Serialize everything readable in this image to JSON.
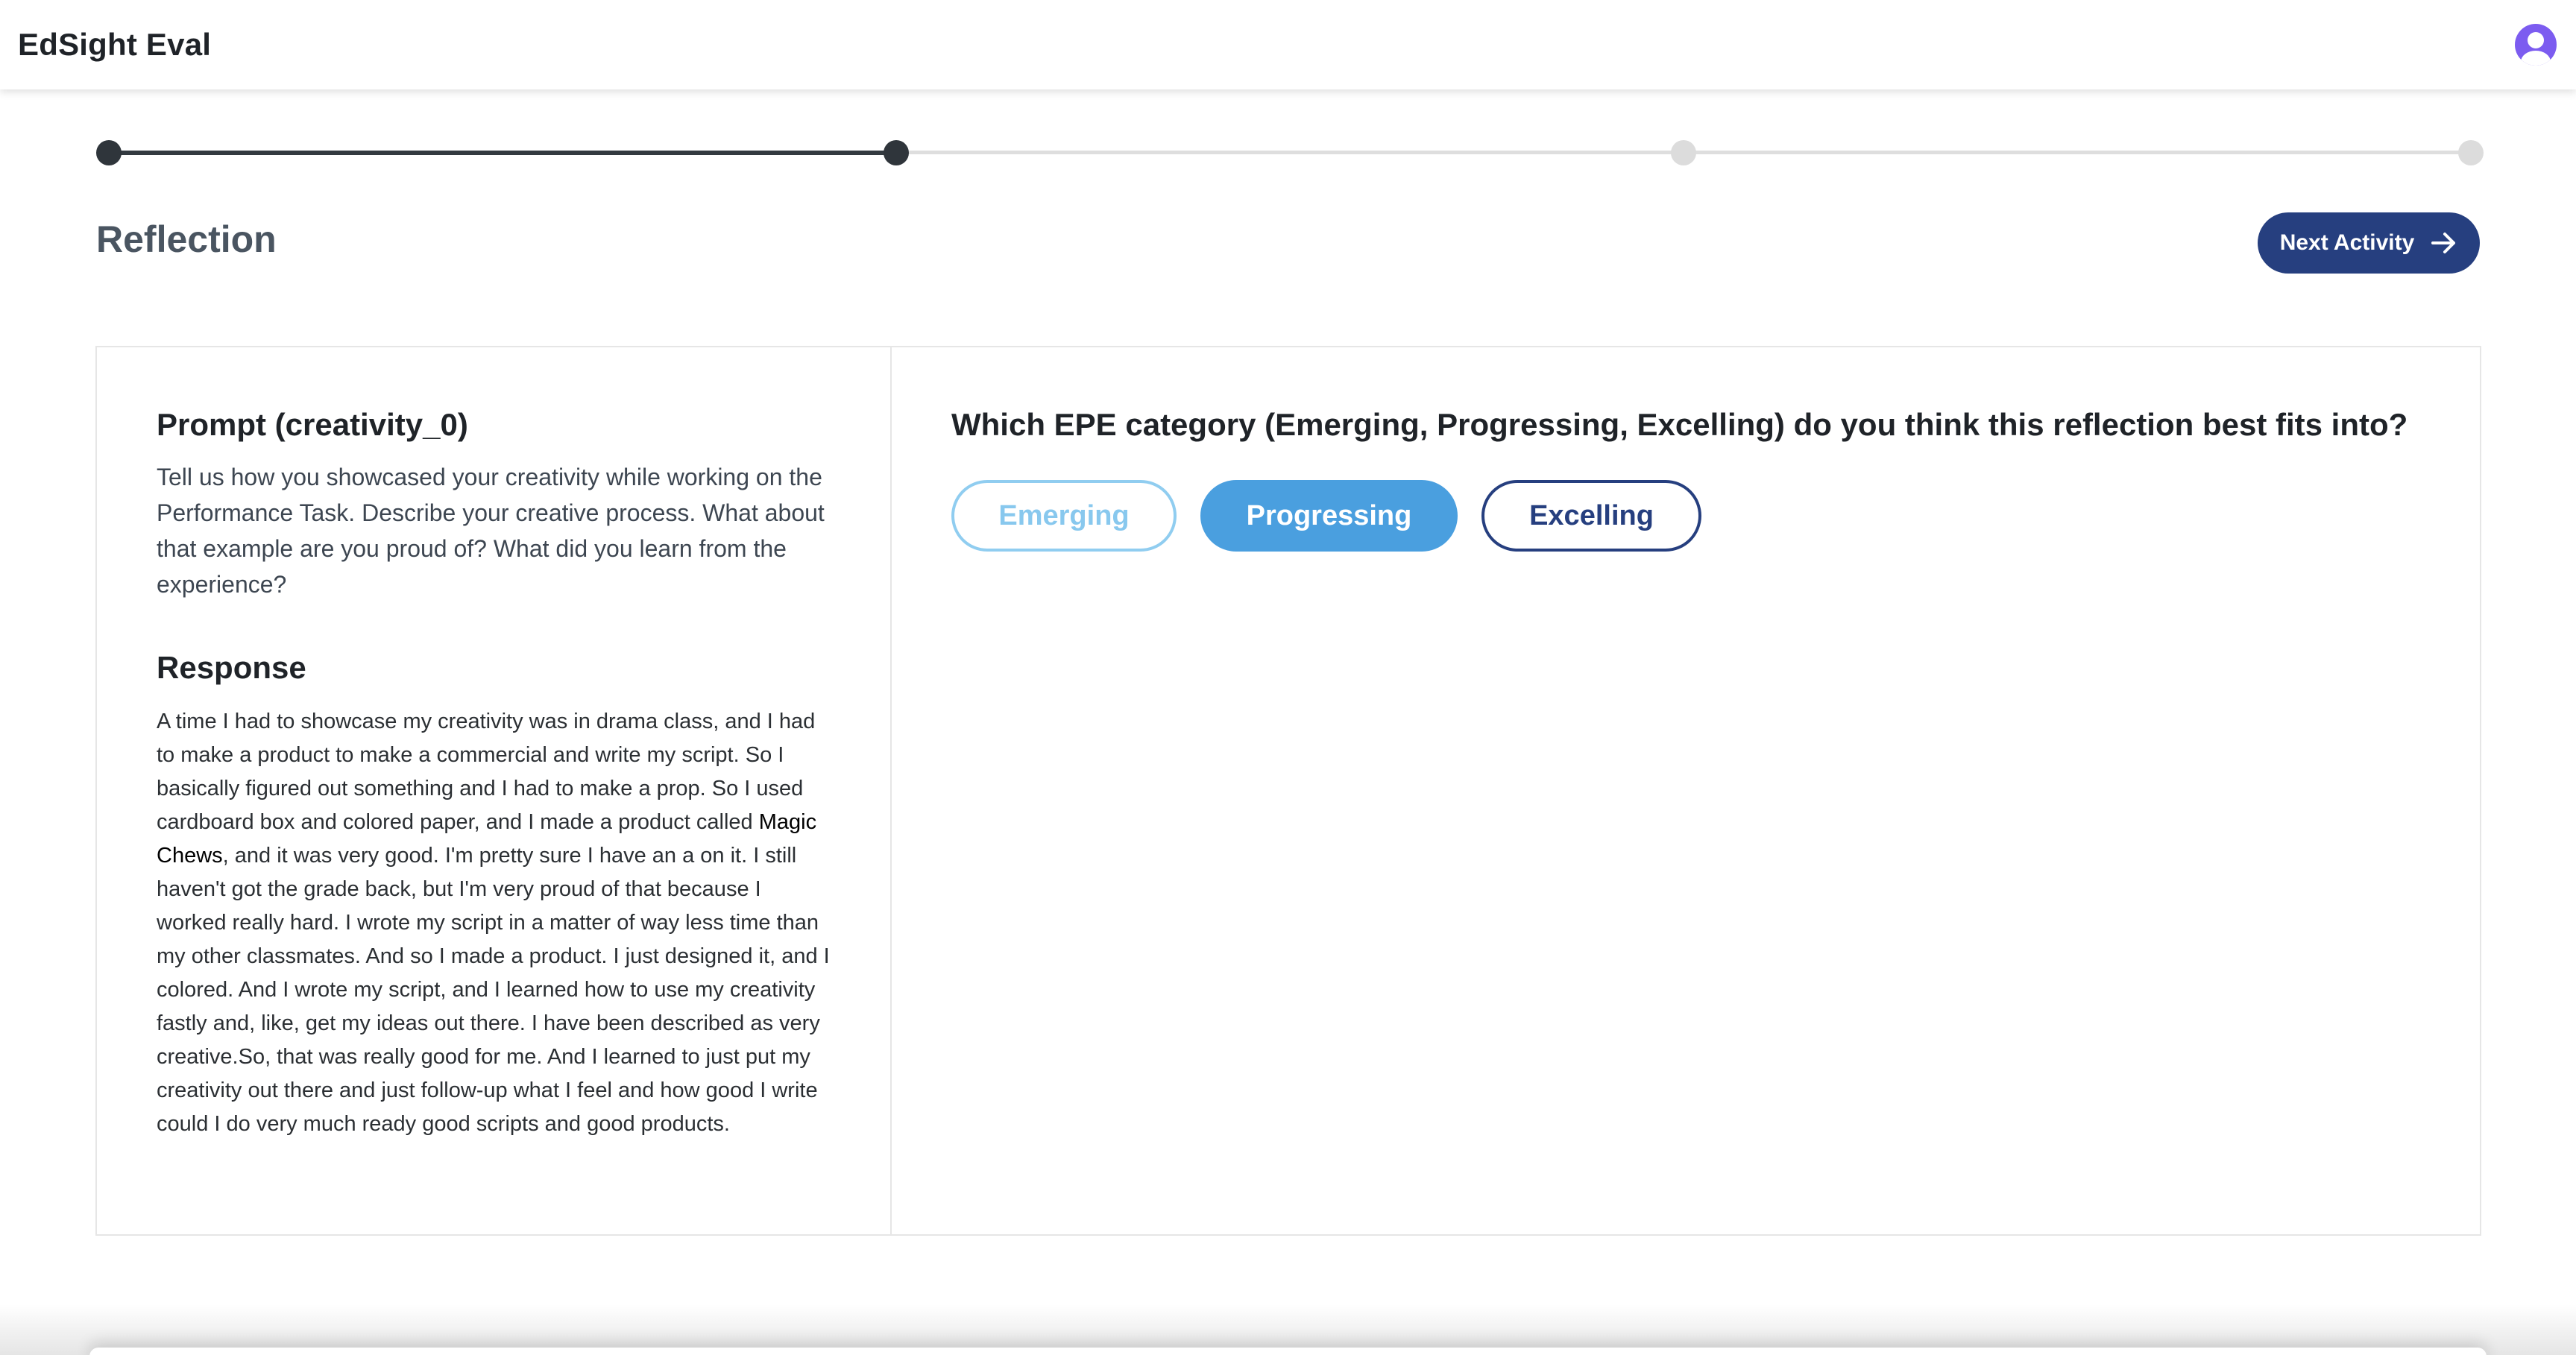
{
  "app": {
    "title": "EdSight Eval"
  },
  "user": {
    "avatar_icon": "user-avatar-icon",
    "avatar_color": "#7c5cf0"
  },
  "stepper": {
    "total_steps": 4,
    "current_step": 2,
    "completed_color": "#2f353b",
    "pending_color": "#dcdcdc"
  },
  "header": {
    "section_title": "Reflection",
    "next_button_label": "Next Activity",
    "next_button_icon": "arrow-right-icon",
    "accent_color": "#263f7f"
  },
  "prompt": {
    "title": "Prompt (creativity_0)",
    "text": "Tell us how you showcased your creativity while working on the Performance Task. Describe your creative process. What about that example are you proud of? What did you learn from the experience?"
  },
  "response": {
    "title": "Response",
    "text_before": "A time I had to showcase my creativity was in drama class, and I had to make a product to make a commercial and write my script. So I basically figured out something and I had to make a prop. So I used cardboard box and colored paper, and I made a product called ",
    "highlight": "Magic Chews",
    "text_after": ", and it was very good. I'm pretty sure I have an a on it. I still haven't got the grade back, but I'm very proud of that because I worked really hard. I wrote my script in a matter of way less time than my other classmates. And so I made a product. I just designed it, and I colored. And I wrote my script, and I learned how to use my creativity fastly and, like, get my ideas out there. I have been described as very creative.So, that was really good for me. And I learned to just put my creativity out there and just follow-up what I feel and how good I write could I do very much ready good scripts and good products."
  },
  "question": {
    "text": "Which EPE category (Emerging, Progressing, Excelling) do you think this reflection best fits into?",
    "options": [
      {
        "label": "Emerging",
        "state": "unselected-light"
      },
      {
        "label": "Progressing",
        "state": "selected"
      },
      {
        "label": "Excelling",
        "state": "unselected"
      }
    ],
    "selected": "Progressing",
    "selected_color": "#4a9fdf"
  }
}
